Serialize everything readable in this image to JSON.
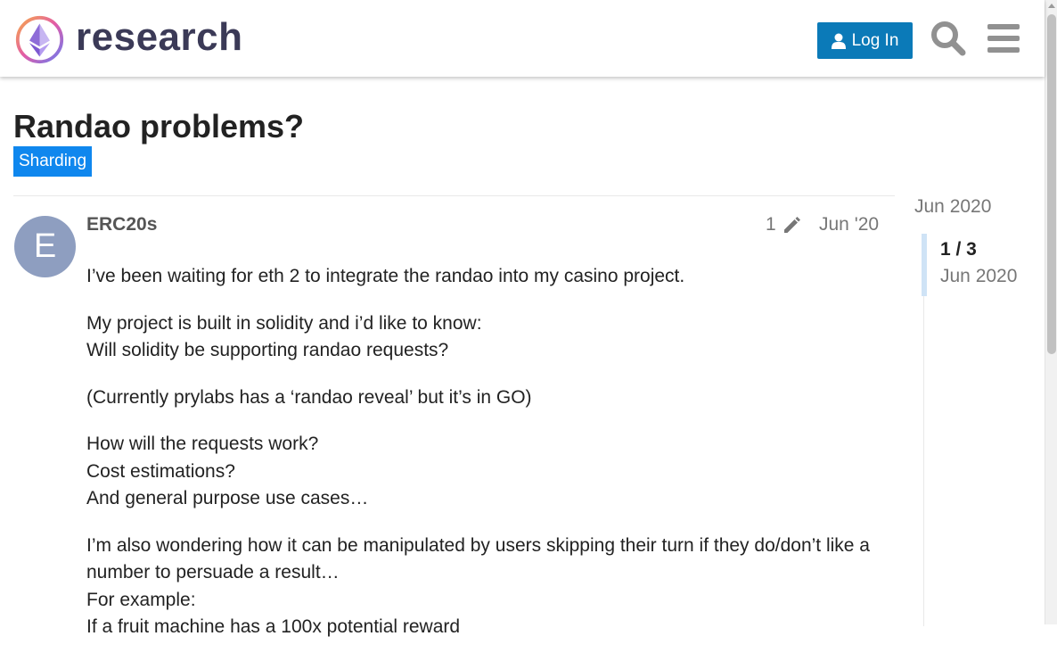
{
  "site": {
    "name": "research",
    "logo_icon": "ethereum-diamond-logo"
  },
  "header": {
    "login_label": "Log In",
    "search_icon": "search-icon",
    "menu_icon": "hamburger-menu-icon"
  },
  "colors": {
    "accent": "#0b7ab8",
    "category": "#0f87ee",
    "avatar": "#8e9ec0"
  },
  "topic": {
    "title": "Randao problems?",
    "category": "Sharding"
  },
  "post": {
    "avatar_letter": "E",
    "username": "ERC20s",
    "edit_count": "1",
    "date": "Jun '20",
    "paragraphs": [
      [
        "I’ve been waiting for eth 2 to integrate the randao into my casino project."
      ],
      [
        "My project is built in solidity and i’d like to know:",
        "Will solidity be supporting randao requests?"
      ],
      [
        "(Currently prylabs has a ‘randao reveal’ but it’s in GO)"
      ],
      [
        "How will the requests work?",
        "Cost estimations?",
        "And general purpose use cases…"
      ],
      [
        "I’m also wondering how it can be manipulated by users skipping their turn if they do/don’t like a number to persuade a result…",
        "For example:",
        "If a fruit machine has a 100x potential reward"
      ]
    ]
  },
  "timeline": {
    "start": "Jun 2020",
    "position": "1 / 3",
    "position_date": "Jun 2020"
  }
}
